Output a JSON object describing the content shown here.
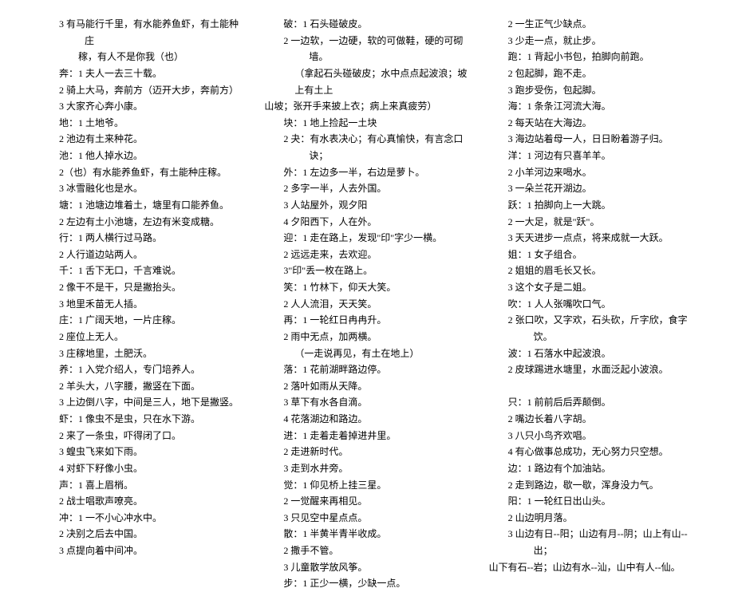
{
  "columns": [
    {
      "lines": [
        {
          "cls": "num-line",
          "text": "3 有马能行千里，有水能养鱼虾，有土能种庄"
        },
        {
          "cls": "cont-line",
          "text": "　　稼，有人不是你我（也）"
        },
        {
          "cls": "char-line first",
          "text": "奔：1 夫人一去三十载。"
        },
        {
          "cls": "num-line",
          "text": "2 骑上大马，奔前方（迈开大步，奔前方）"
        },
        {
          "cls": "num-line",
          "text": "3 大家齐心奔小康。"
        },
        {
          "cls": "char-line first",
          "text": "地：1 土地爷。"
        },
        {
          "cls": "num-line",
          "text": "2 池边有土来种花。"
        },
        {
          "cls": "char-line first",
          "text": "池：1 他人掉水边。"
        },
        {
          "cls": "num-line",
          "text": "2（也）有水能养鱼虾，有土能种庄稼。"
        },
        {
          "cls": "num-line",
          "text": "3 冰雪融化也是水。"
        },
        {
          "cls": "char-line first",
          "text": "塘：1 池塘边堆着土，塘里有口能养鱼。"
        },
        {
          "cls": "num-line",
          "text": "2 左边有土小池塘，左边有米变成糖。"
        },
        {
          "cls": "char-line first",
          "text": "行：1 两人横行过马路。"
        },
        {
          "cls": "num-line",
          "text": "2 人行道边站两人。"
        },
        {
          "cls": "char-line first",
          "text": "千：1 舌下无口，千言难说。"
        },
        {
          "cls": "num-line",
          "text": "2 像干不是干，只是撇抬头。"
        },
        {
          "cls": "num-line",
          "text": "3 地里禾苗无人插。"
        },
        {
          "cls": "char-line first",
          "text": "庄：1 广阔天地，一片庄稼。"
        },
        {
          "cls": "num-line",
          "text": "2 座位上无人。"
        },
        {
          "cls": "num-line",
          "text": "3 庄稼地里，土肥沃。"
        },
        {
          "cls": "char-line first",
          "text": "养：1 入党介绍人，专门培养人。"
        },
        {
          "cls": "num-line",
          "text": "2 羊头大，八字腰，撇竖在下面。"
        },
        {
          "cls": "num-line",
          "text": "3 上边倒八字，中间是三人，地下是撇竖。"
        },
        {
          "cls": "char-line first",
          "text": "虾：1 像虫不是虫，只在水下游。"
        },
        {
          "cls": "num-line",
          "text": "2 来了一条虫，吓得闭了口。"
        },
        {
          "cls": "num-line",
          "text": "3 蝗虫飞来如下雨。"
        },
        {
          "cls": "num-line",
          "text": "4 对虾下籽像小虫。"
        },
        {
          "cls": "char-line first",
          "text": "声：1 喜上眉梢。"
        },
        {
          "cls": "num-line",
          "text": "2 战士唱歌声嘹亮。"
        },
        {
          "cls": "char-line first",
          "text": "冲：1 一不小心冲水中。"
        },
        {
          "cls": "num-line",
          "text": "2 决别之后去中国。"
        },
        {
          "cls": "num-line",
          "text": "3 点提向着中间冲。"
        }
      ]
    },
    {
      "lines": [
        {
          "cls": "char-line first",
          "text": "破：1 石头碰破皮。"
        },
        {
          "cls": "num-line",
          "text": "2 一边软，一边硬，软的可做鞋，硬的可砌墙。"
        },
        {
          "cls": "paren-line",
          "text": "（拿起石头碰破皮；水中点点起波浪；坡上有土上"
        },
        {
          "cls": "plain-line",
          "text": "山坡；张开手来披上衣；病上来真疲劳）"
        },
        {
          "cls": "char-line first",
          "text": "块：1 地上捡起一土块"
        },
        {
          "cls": "num-line",
          "text": "2 夬：有水表决心；有心真愉快，有言念口诀；"
        },
        {
          "cls": "char-line first",
          "text": "外：1 左边多一半，右边是萝卜。"
        },
        {
          "cls": "num-line",
          "text": "2 多字一半，人去外国。"
        },
        {
          "cls": "num-line",
          "text": "3 人站屋外，观夕阳"
        },
        {
          "cls": "num-line",
          "text": "4 夕阳西下，人在外。"
        },
        {
          "cls": "char-line first",
          "text": "迎：1 走在路上，发现\"印\"字少一横。"
        },
        {
          "cls": "num-line",
          "text": "2 远远走来，去欢迎。"
        },
        {
          "cls": "num-line",
          "text": "3\"印\"丢一枚在路上。"
        },
        {
          "cls": "char-line first",
          "text": "笑：1 竹林下，仰天大笑。"
        },
        {
          "cls": "num-line",
          "text": "2 人人流泪，天天笑。"
        },
        {
          "cls": "char-line first",
          "text": "再：1 一轮红日冉冉升。"
        },
        {
          "cls": "num-line",
          "text": "2 雨中无点，加两横。"
        },
        {
          "cls": "paren-line",
          "text": "（一走说再见，有土在地上）"
        },
        {
          "cls": "char-line first",
          "text": "落：1 花前湖畔路边停。"
        },
        {
          "cls": "num-line",
          "text": "2 落叶如雨从天降。"
        },
        {
          "cls": "num-line",
          "text": "3 草下有水各自滴。"
        },
        {
          "cls": "num-line",
          "text": "4 花落湖边和路边。"
        },
        {
          "cls": "char-line first",
          "text": "进：1 走着走着掉进井里。"
        },
        {
          "cls": "num-line",
          "text": "2 走进新时代。"
        },
        {
          "cls": "num-line",
          "text": "3 走到水井旁。"
        },
        {
          "cls": "char-line first",
          "text": "觉：1 仰见桥上挂三星。"
        },
        {
          "cls": "num-line",
          "text": "2 一觉醒来再相见。"
        },
        {
          "cls": "num-line",
          "text": "3 只见空中星点点。"
        },
        {
          "cls": "char-line first",
          "text": "散：1 半黄半青半收成。"
        },
        {
          "cls": "num-line",
          "text": "2 撒手不管。"
        },
        {
          "cls": "num-line",
          "text": "3 儿童散学放风筝。"
        },
        {
          "cls": "char-line first",
          "text": "步：1 正少一横，少缺一点。"
        }
      ]
    },
    {
      "lines": [
        {
          "cls": "num-line",
          "text": "2 一生正气少缺点。"
        },
        {
          "cls": "num-line",
          "text": "3 少走一点，就止步。"
        },
        {
          "cls": "char-line first",
          "text": "跑：1 背起小书包，拍脚向前跑。"
        },
        {
          "cls": "num-line",
          "text": "2 包起脚，跑不走。"
        },
        {
          "cls": "num-line",
          "text": "3 跑步受伤，包起脚。"
        },
        {
          "cls": "char-line first",
          "text": "海：1 条条江河流大海。"
        },
        {
          "cls": "num-line",
          "text": "2 每天站在大海边。"
        },
        {
          "cls": "num-line",
          "text": "3 海边站着母一人，日日盼着游子归。"
        },
        {
          "cls": "char-line first",
          "text": "洋：1 河边有只喜羊羊。"
        },
        {
          "cls": "num-line",
          "text": "2 小羊河边来喝水。"
        },
        {
          "cls": "num-line",
          "text": "3 一朵兰花开湖边。"
        },
        {
          "cls": "char-line first",
          "text": "跃：1 拍脚向上一大跳。"
        },
        {
          "cls": "num-line",
          "text": "2 一大足，就是\"跃\"。"
        },
        {
          "cls": "num-line",
          "text": "3 天天进步一点点，将来成就一大跃。"
        },
        {
          "cls": "char-line first",
          "text": "姐：1 女子组合。"
        },
        {
          "cls": "num-line",
          "text": "2 姐姐的眉毛长又长。"
        },
        {
          "cls": "num-line",
          "text": "3 这个女子是二姐。"
        },
        {
          "cls": "char-line first",
          "text": "吹：1 人人张嘴吹口气。"
        },
        {
          "cls": "num-line",
          "text": "2 张口吹，又字欢，石头砍，斤字欣，食字饮。"
        },
        {
          "cls": "char-line first",
          "text": "波：1 石落水中起波浪。"
        },
        {
          "cls": "num-line",
          "text": "2 皮球踢进水塘里，水面泛起小波浪。"
        },
        {
          "cls": "plain-line",
          "text": "　"
        },
        {
          "cls": "char-line first",
          "text": "只：1 前前后后弄颠倒。"
        },
        {
          "cls": "num-line",
          "text": "2 嘴边长着八字胡。"
        },
        {
          "cls": "num-line",
          "text": "3 八只小鸟齐欢唱。"
        },
        {
          "cls": "num-line",
          "text": "4 有心做事总成功，无心努力只空想。"
        },
        {
          "cls": "char-line first",
          "text": "边：1 路边有个加油站。"
        },
        {
          "cls": "num-line",
          "text": "2 走到路边，歇一歇，浑身没力气。"
        },
        {
          "cls": "char-line first",
          "text": "阳：1 一轮红日出山头。"
        },
        {
          "cls": "num-line",
          "text": "2 山边明月落。"
        },
        {
          "cls": "num-line",
          "text": "3 山边有日--阳；山边有月--阴；山上有山--出；"
        },
        {
          "cls": "plain-line",
          "text": "山下有石--岩；山边有水--汕，山中有人--仙。"
        }
      ]
    }
  ]
}
